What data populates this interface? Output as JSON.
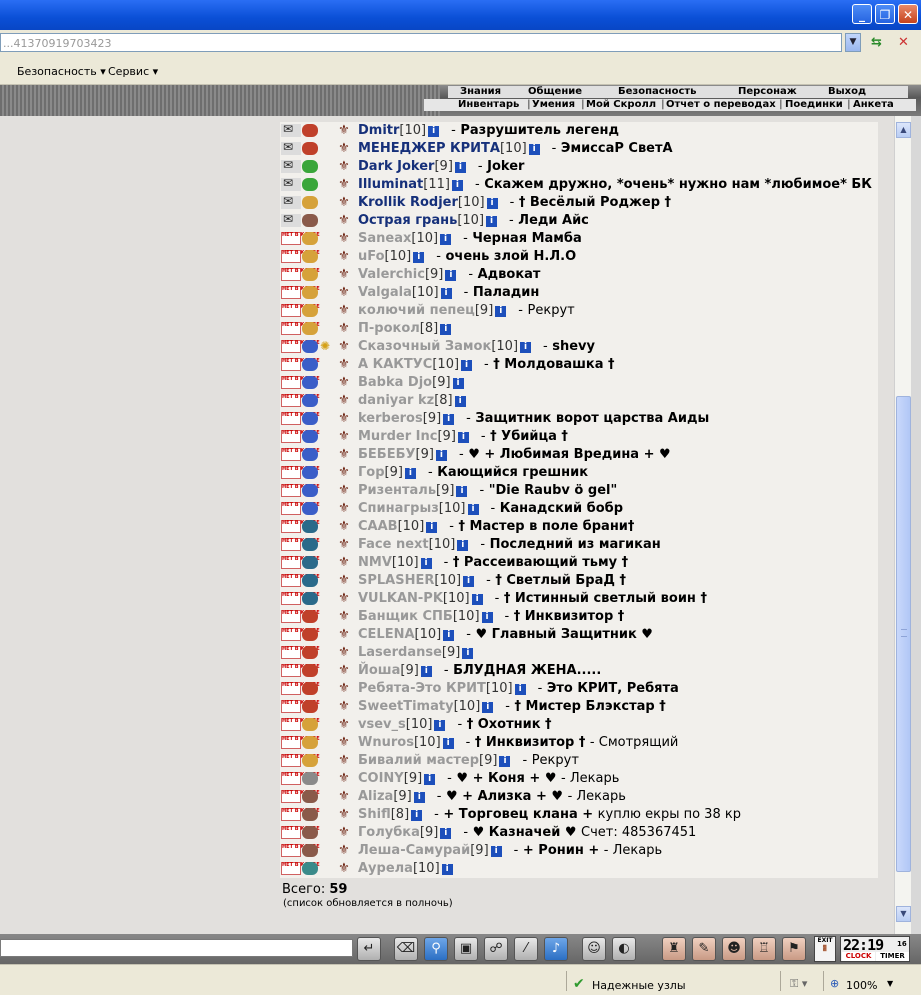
{
  "browser": {
    "address": "...41370919703423",
    "menu": [
      "Безопасность",
      "Сервис"
    ],
    "status_zone": "Надежные узлы",
    "zoom": "100%"
  },
  "game_nav": {
    "top": [
      "Знания",
      "Общение",
      "Безопасность",
      "Персонаж",
      "Выход"
    ],
    "bottom": [
      "Инвентарь",
      "Умения",
      "Мой Скролл",
      "Отчет о переводах",
      "Поединки",
      "Анкета"
    ]
  },
  "members": [
    {
      "nick": "Dmitr",
      "level": "10",
      "status": "Разрушитель легенд",
      "extra": "",
      "online": true,
      "align": "#c0402a"
    },
    {
      "nick": "МЕНЕДЖЕР КРИТА",
      "level": "10",
      "status": "ЭмиссаР СветА",
      "extra": "",
      "online": true,
      "align": "#c0402a"
    },
    {
      "nick": "Dark Joker",
      "level": "9",
      "status": "Joker",
      "extra": "",
      "online": true,
      "align": "#3aa63a"
    },
    {
      "nick": "Illuminat",
      "level": "11",
      "status": "Скажем дружно, *очень* нужно нам *любимое* БК",
      "extra": "",
      "online": true,
      "align": "#3aa63a"
    },
    {
      "nick": "Krollik Rodjer",
      "level": "10",
      "status": "† Весёлый Роджер †",
      "extra": "",
      "online": true,
      "align": "#d6a23a"
    },
    {
      "nick": "Острая грань",
      "level": "10",
      "status": "Леди Айс",
      "extra": "",
      "online": true,
      "align": "#8a5a4a"
    },
    {
      "nick": "Saneax",
      "level": "10",
      "status": "Черная Мамба",
      "extra": "",
      "online": false,
      "align": "#d6a23a"
    },
    {
      "nick": "uFo",
      "level": "10",
      "status": "очень злой Н.Л.О",
      "extra": "",
      "online": false,
      "align": "#d6a23a"
    },
    {
      "nick": "Valerchic",
      "level": "9",
      "status": "Адвокат",
      "extra": "",
      "online": false,
      "align": "#d6a23a"
    },
    {
      "nick": "Valgala",
      "level": "10",
      "status": "Паладин",
      "extra": "",
      "online": false,
      "align": "#d6a23a"
    },
    {
      "nick": "колючий пепец",
      "level": "9",
      "status": "",
      "extra": "Рекрут",
      "online": false,
      "align": "#d6a23a"
    },
    {
      "nick": "П-рокол",
      "level": "8",
      "status": "",
      "extra": "",
      "online": false,
      "align": "#d6a23a"
    },
    {
      "nick": "Сказочный Замок",
      "level": "10",
      "status": "shevy",
      "extra": "",
      "online": false,
      "align": "#3a5ec8"
    },
    {
      "nick": "А КАКТУС",
      "level": "10",
      "status": "† Молдовашка †",
      "extra": "",
      "online": false,
      "align": "#3a5ec8"
    },
    {
      "nick": "Babka Djo",
      "level": "9",
      "status": "",
      "extra": "",
      "online": false,
      "align": "#3a5ec8"
    },
    {
      "nick": "daniyar kz",
      "level": "8",
      "status": "",
      "extra": "",
      "online": false,
      "align": "#3a5ec8"
    },
    {
      "nick": "kerberos",
      "level": "9",
      "status": "Защитник ворот царства Аиды",
      "extra": "",
      "online": false,
      "align": "#3a5ec8"
    },
    {
      "nick": "Murder Inc",
      "level": "9",
      "status": "† Убийца †",
      "extra": "",
      "online": false,
      "align": "#3a5ec8"
    },
    {
      "nick": "БЕБЕБУ",
      "level": "9",
      "status": "♥ + Любимая Вредина + ♥",
      "extra": "",
      "online": false,
      "align": "#3a5ec8"
    },
    {
      "nick": "Гор",
      "level": "9",
      "status": "Кающийся грешник",
      "extra": "",
      "online": false,
      "align": "#3a5ec8"
    },
    {
      "nick": "Ризенталь",
      "level": "9",
      "status": "\"Die Raubv ö gel\"",
      "extra": "",
      "online": false,
      "align": "#3a5ec8"
    },
    {
      "nick": "Спинагрыз",
      "level": "10",
      "status": "Канадский бобр",
      "extra": "",
      "online": false,
      "align": "#3a5ec8"
    },
    {
      "nick": "CAAB",
      "level": "10",
      "status": "† Мастер в поле брани†",
      "extra": "",
      "online": false,
      "align": "#2a6a8a"
    },
    {
      "nick": "Face next",
      "level": "10",
      "status": "Последний из магикан",
      "extra": "",
      "online": false,
      "align": "#2a6a8a"
    },
    {
      "nick": "NMV",
      "level": "10",
      "status": "† Рассеивающий тьму †",
      "extra": "",
      "online": false,
      "align": "#2a6a8a"
    },
    {
      "nick": "SPLASHER",
      "level": "10",
      "status": "† Светлый БраД †",
      "extra": "",
      "online": false,
      "align": "#2a6a8a"
    },
    {
      "nick": "VULKAN-PK",
      "level": "10",
      "status": "† Истинный светлый воин †",
      "extra": "",
      "online": false,
      "align": "#2a6a8a"
    },
    {
      "nick": "Банщик СПБ",
      "level": "10",
      "status": "† Инквизитор †",
      "extra": "",
      "online": false,
      "align": "#c0402a"
    },
    {
      "nick": "CELENA",
      "level": "10",
      "status": "♥ Главный Защитник ♥",
      "extra": "",
      "online": false,
      "align": "#c0402a"
    },
    {
      "nick": "Laserdanse",
      "level": "9",
      "status": "",
      "extra": "",
      "online": false,
      "align": "#c0402a"
    },
    {
      "nick": "Йоша",
      "level": "9",
      "status": "БЛУДНАЯ ЖЕНА.....",
      "extra": "",
      "online": false,
      "align": "#c0402a"
    },
    {
      "nick": "Ребята-Это КРИТ",
      "level": "10",
      "status": "Это КРИТ, Ребята",
      "extra": "",
      "online": false,
      "align": "#c0402a"
    },
    {
      "nick": "SweetTimaty",
      "level": "10",
      "status": "† Мистер Блэкстар †",
      "extra": "",
      "online": false,
      "align": "#c0402a"
    },
    {
      "nick": "vsev_s",
      "level": "10",
      "status": "† Охотник †",
      "extra": "",
      "online": false,
      "align": "#d6a23a"
    },
    {
      "nick": "Wnuros",
      "level": "10",
      "status": "† Инквизитор †",
      "extra": "- Смотрящий",
      "online": false,
      "align": "#d6a23a"
    },
    {
      "nick": "Бивалий мастер",
      "level": "9",
      "status": "",
      "extra": "Рекрут",
      "online": false,
      "align": "#d6a23a"
    },
    {
      "nick": "COINY",
      "level": "9",
      "status": "♥ + Коня + ♥",
      "extra": "- Лекарь",
      "online": false,
      "align": "#8a8a8a"
    },
    {
      "nick": "Aliza",
      "level": "9",
      "status": "♥ + Ализка + ♥",
      "extra": "- Лекарь",
      "online": false,
      "align": "#8a5a4a"
    },
    {
      "nick": "Shifl",
      "level": "8",
      "status": "+ Торговец клана +",
      "extra": "куплю екры по 38 кр",
      "online": false,
      "align": "#8a5a4a"
    },
    {
      "nick": "Голубка",
      "level": "9",
      "status": "♥ Казначей ♥",
      "extra": "Счет: 485367451",
      "online": false,
      "align": "#8a5a4a"
    },
    {
      "nick": "Леша-Самурай",
      "level": "9",
      "status": "+ Ронин +",
      "extra": "- Лекарь",
      "online": false,
      "align": "#8a5a4a"
    },
    {
      "nick": "Аурела",
      "level": "10",
      "status": "",
      "extra": "",
      "online": false,
      "align": "#3a8a8a"
    }
  ],
  "summary": {
    "total_label": "Всего:",
    "total_count": "59",
    "refresh_note": "(список обновляется в полночь)"
  },
  "clock": {
    "time": "22:19",
    "seconds": "16",
    "clock_label": "CLOCK",
    "timer_label": "TIMER",
    "exit_label": "EXIT"
  },
  "labels": {
    "offline": "НЕТ В КЛУБЕ",
    "level_open": "[",
    "level_close": "]",
    "info": "i",
    "dash": "-"
  }
}
